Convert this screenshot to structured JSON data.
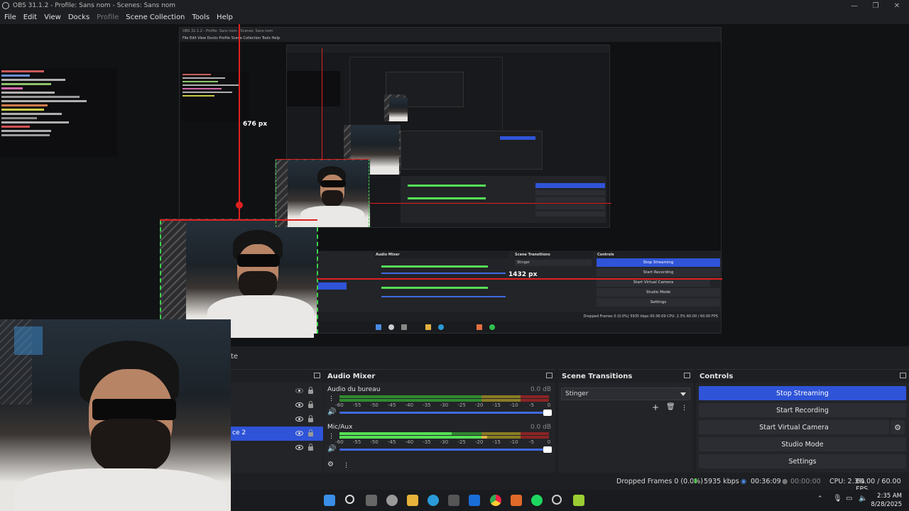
{
  "window": {
    "title": "OBS 31.1.2 - Profile: Sans nom - Scenes: Sans nom",
    "minimize": "—",
    "maximize": "❐",
    "close": "✕"
  },
  "menu": [
    "File",
    "Edit",
    "View",
    "Docks",
    "Profile",
    "Scene Collection",
    "Tools",
    "Help"
  ],
  "preview": {
    "measure_vertical": "676 px",
    "measure_horizontal": "1432 px",
    "nested_title": "OBS 31.1.2 - Profile: Sans nom - Scenes: Sans nom"
  },
  "docks": {
    "partial_tab": "te",
    "sources": {
      "selected_label": "ce 2"
    },
    "mixer": {
      "title": "Audio Mixer",
      "channels": [
        {
          "name": "Audio du bureau",
          "db": "0.0 dB"
        },
        {
          "name": "Mic/Aux",
          "db": "0.0 dB"
        }
      ],
      "ticks": [
        "-60",
        "-55",
        "-50",
        "-45",
        "-40",
        "-35",
        "-30",
        "-25",
        "-20",
        "-15",
        "-10",
        "-5",
        "0"
      ]
    },
    "transitions": {
      "title": "Scene Transitions",
      "selected": "Stinger"
    },
    "controls": {
      "title": "Controls",
      "stop_streaming": "Stop Streaming",
      "start_recording": "Start Recording",
      "start_virtual_camera": "Start Virtual Camera",
      "studio_mode": "Studio Mode",
      "settings": "Settings"
    }
  },
  "status": {
    "dropped_frames": "Dropped Frames 0 (0.0%)",
    "bitrate": "5935 kbps",
    "stream_time": "00:36:09",
    "rec_time": "00:00:00",
    "cpu": "CPU: 2.3%",
    "fps": "60.00 / 60.00 FPS"
  },
  "taskbar": {
    "time": "2:35 AM",
    "date": "8/28/2025"
  },
  "colors": {
    "accent": "#2f54d8",
    "meter_green": "#55e055",
    "guide_red": "#e02020",
    "guide_green": "#3cd24c"
  }
}
